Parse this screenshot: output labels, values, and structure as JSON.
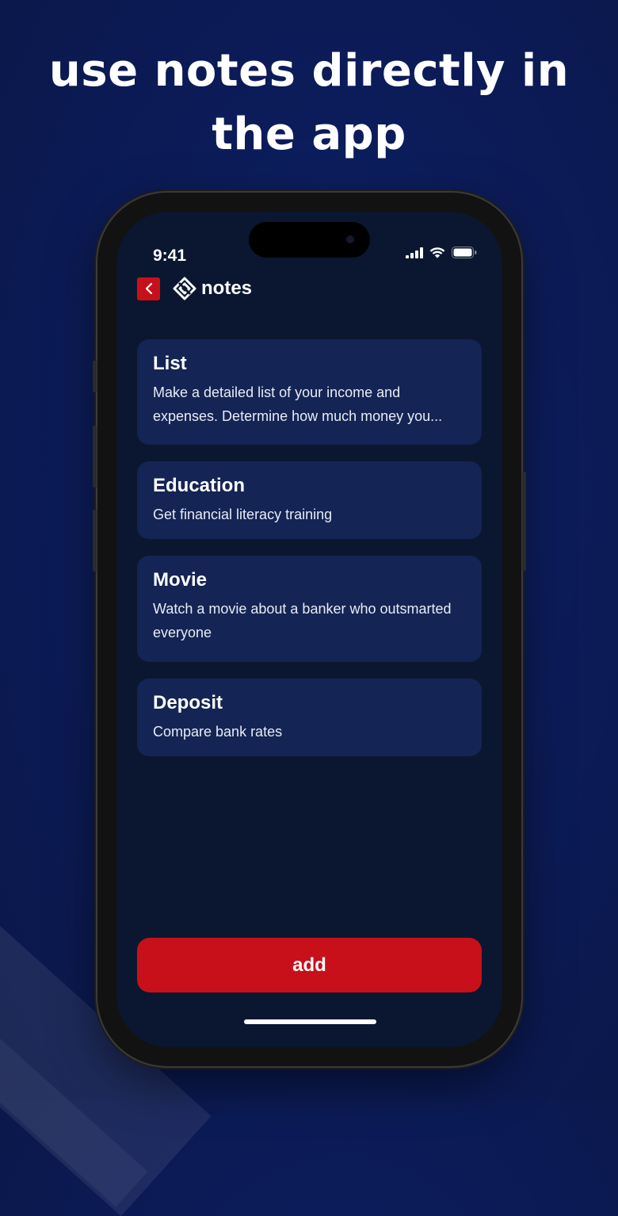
{
  "headline": {
    "line1": "use notes directly in",
    "line2": "the app"
  },
  "status_bar": {
    "time": "9:41",
    "icons": [
      "cellular-signal-icon",
      "wifi-icon",
      "battery-icon"
    ]
  },
  "header": {
    "back_icon": "chevron-left-icon",
    "logo_icon": "notes-logo-icon",
    "title": "notes"
  },
  "notes": [
    {
      "title": "List",
      "description": "Make a detailed list of your income and expenses. Determine how much money you..."
    },
    {
      "title": "Education",
      "description": "Get financial literacy training"
    },
    {
      "title": "Movie",
      "description": "Watch a movie about a banker who outsmarted everyone"
    },
    {
      "title": "Deposit",
      "description": "Compare bank rates"
    }
  ],
  "actions": {
    "add_label": "add"
  },
  "colors": {
    "accent": "#c8101a",
    "screen_background": "#0b1730",
    "card_background": "#142454",
    "page_background": "#0c1c5a"
  }
}
